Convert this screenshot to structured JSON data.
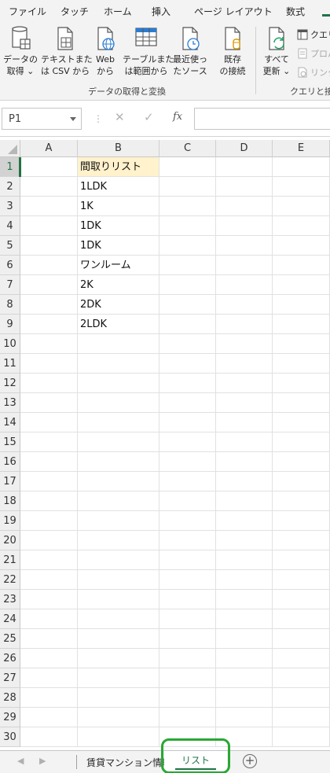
{
  "ribbon_tabs": [
    {
      "label": "ファイル"
    },
    {
      "label": "タッチ"
    },
    {
      "label": "ホーム"
    },
    {
      "label": "挿入"
    },
    {
      "label": "ページ レイアウト"
    },
    {
      "label": "数式"
    }
  ],
  "ribbon": {
    "get_data": {
      "line1": "データの",
      "line2": "取得 ⌄"
    },
    "from_text_csv": {
      "line1": "テキストまた",
      "line2": "は CSV から"
    },
    "from_web": {
      "line1": "Web",
      "line2": "から"
    },
    "from_table": {
      "line1": "テーブルまた",
      "line2": "は範囲から"
    },
    "recent_sources": {
      "line1": "最近使っ",
      "line2": "たソース"
    },
    "existing_connections": {
      "line1": "既存",
      "line2": "の接続"
    },
    "refresh_all": {
      "line1": "すべて",
      "line2": "更新 ⌄"
    },
    "queries": "クエリ",
    "properties": "プロパ",
    "links": "リンク",
    "group_get_transform": "データの取得と変換",
    "group_queries": "クエリと接続"
  },
  "formula_bar": {
    "name_box": "P1",
    "cancel": "✕",
    "enter": "✓",
    "fx": "fx",
    "formula": ""
  },
  "columns": [
    "A",
    "B",
    "C",
    "D",
    "E"
  ],
  "rows": [
    "1",
    "2",
    "3",
    "4",
    "5",
    "6",
    "7",
    "8",
    "9",
    "10",
    "11",
    "12",
    "13",
    "14",
    "15",
    "16",
    "17",
    "18",
    "19",
    "20",
    "21",
    "22",
    "23",
    "24",
    "25",
    "26",
    "27",
    "28",
    "29",
    "30"
  ],
  "cells_b": [
    "間取りリスト",
    "1LDK",
    "1K",
    "1DK",
    "1DK",
    "ワンルーム",
    "2K",
    "2DK",
    "2LDK"
  ],
  "sheets": [
    {
      "label": "賃貸マンション情報"
    },
    {
      "label": "リスト"
    }
  ],
  "colors": {
    "accent": "#217346",
    "header_highlight": "#fff2cc",
    "annotation_ring": "#29a834"
  }
}
